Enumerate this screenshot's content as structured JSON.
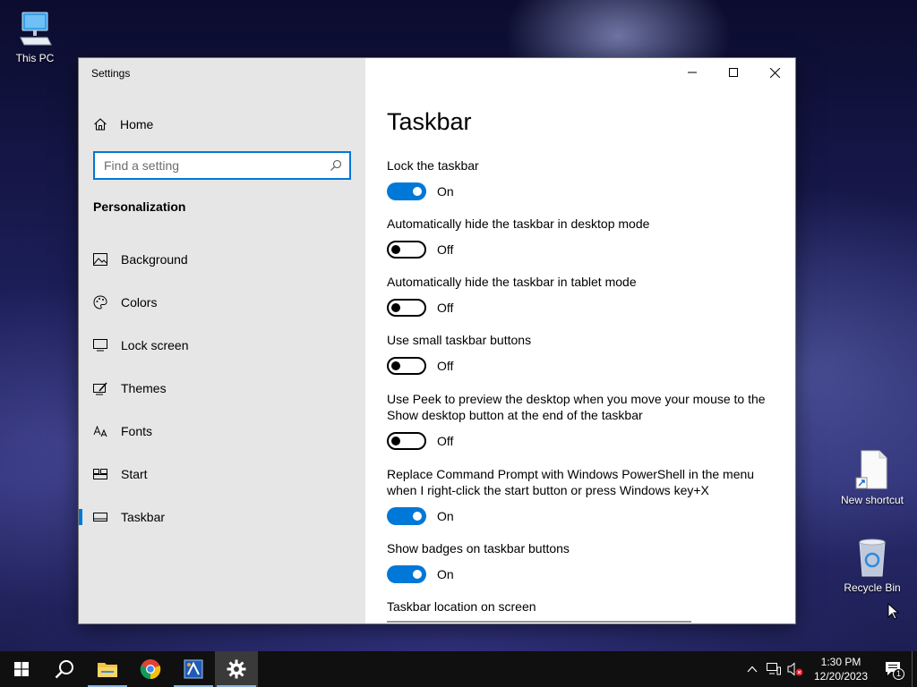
{
  "desktop": {
    "this_pc": "This PC",
    "new_shortcut": "New shortcut",
    "recycle_bin": "Recycle Bin"
  },
  "window": {
    "title": "Settings"
  },
  "sidebar": {
    "home": "Home",
    "search_placeholder": "Find a setting",
    "section": "Personalization",
    "items": [
      {
        "label": "Background",
        "icon": "picture-icon"
      },
      {
        "label": "Colors",
        "icon": "palette-icon"
      },
      {
        "label": "Lock screen",
        "icon": "monitor-icon"
      },
      {
        "label": "Themes",
        "icon": "brush-icon"
      },
      {
        "label": "Fonts",
        "icon": "font-icon"
      },
      {
        "label": "Start",
        "icon": "start-tiles-icon"
      },
      {
        "label": "Taskbar",
        "icon": "taskbar-icon",
        "active": true
      }
    ]
  },
  "page": {
    "title": "Taskbar",
    "settings": [
      {
        "label": "Lock the taskbar",
        "state": "On"
      },
      {
        "label": "Automatically hide the taskbar in desktop mode",
        "state": "Off"
      },
      {
        "label": "Automatically hide the taskbar in tablet mode",
        "state": "Off"
      },
      {
        "label": "Use small taskbar buttons",
        "state": "Off"
      },
      {
        "label": "Use Peek to preview the desktop when you move your mouse to the Show desktop button at the end of the taskbar",
        "state": "Off"
      },
      {
        "label": "Replace Command Prompt with Windows PowerShell in the menu when I right-click the start button or press Windows key+X",
        "state": "On"
      },
      {
        "label": "Show badges on taskbar buttons",
        "state": "On"
      }
    ],
    "location_label": "Taskbar location on screen"
  },
  "taskbar": {
    "time": "1:30 PM",
    "date": "12/20/2023",
    "notification_count": "1"
  },
  "colors": {
    "accent": "#0078d7",
    "sidebar_bg": "#e6e6e6",
    "taskbar_bg": "#101010"
  }
}
